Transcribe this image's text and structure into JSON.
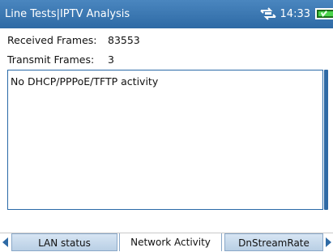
{
  "header": {
    "title": "Line Tests|IPTV Analysis",
    "time": "14:33",
    "network_icon": "network-activity-icon",
    "battery_icon": "battery-charged-icon"
  },
  "stats": {
    "received_label": "Received Frames:",
    "received_value": "83553",
    "transmit_label": "Transmit Frames:",
    "transmit_value": "3"
  },
  "panel": {
    "message": "No DHCP/PPPoE/TFTP activity"
  },
  "tabs": [
    {
      "label": "LAN status"
    },
    {
      "label": "Network Activity"
    },
    {
      "label": "DnStreamRate"
    }
  ],
  "colors": {
    "title_bar": "#2e6aa5",
    "panel_border": "#2a6aa8",
    "battery": "#4bd34b"
  }
}
